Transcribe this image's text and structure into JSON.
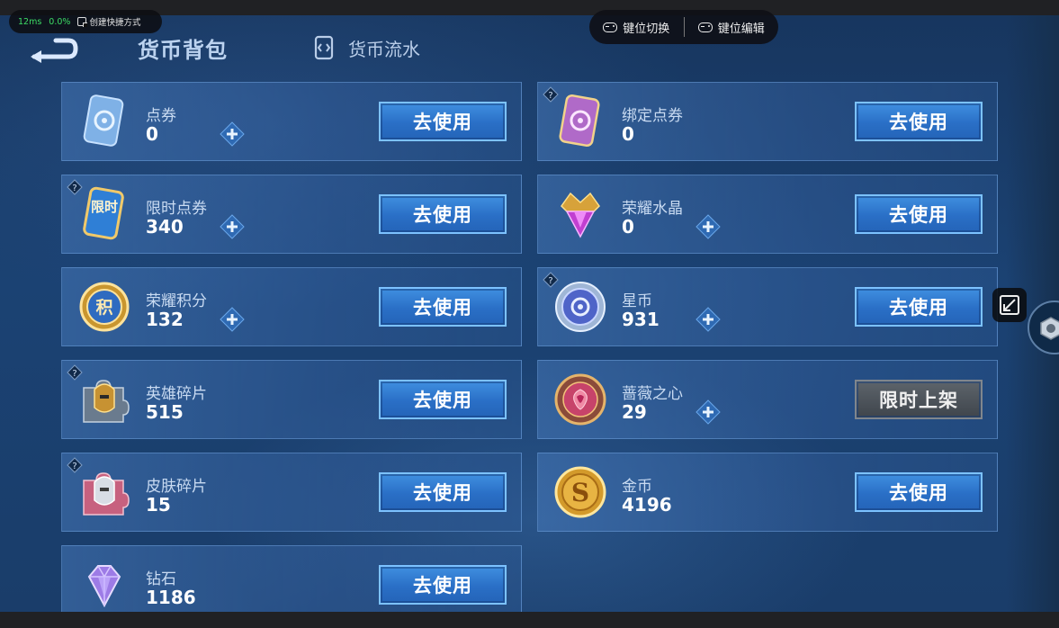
{
  "overlay": {
    "latency": "12ms",
    "loss": "0.0%",
    "shortcut_label": "创建快捷方式",
    "key_switch": "键位切换",
    "key_edit": "键位编辑"
  },
  "header": {
    "active_tab": "货币背包",
    "flow_tab": "货币流水"
  },
  "currencies": [
    {
      "name": "点券",
      "count": "0",
      "button": "去使用"
    },
    {
      "name": "绑定点券",
      "count": "0",
      "button": "去使用"
    },
    {
      "name": "限时点券",
      "count": "340",
      "button": "去使用"
    },
    {
      "name": "荣耀水晶",
      "count": "0",
      "button": "去使用"
    },
    {
      "name": "荣耀积分",
      "count": "132",
      "button": "去使用"
    },
    {
      "name": "星币",
      "count": "931",
      "button": "去使用"
    },
    {
      "name": "英雄碎片",
      "count": "515",
      "button": "去使用"
    },
    {
      "name": "蔷薇之心",
      "count": "29",
      "button": "限时上架"
    },
    {
      "name": "皮肤碎片",
      "count": "15",
      "button": "去使用"
    },
    {
      "name": "金币",
      "count": "4196",
      "button": "去使用"
    },
    {
      "name": "钻石",
      "count": "1186",
      "button": "去使用"
    }
  ],
  "icon_badges": {
    "limited_voucher": "限时",
    "honor_points": "积",
    "gold": "S"
  }
}
